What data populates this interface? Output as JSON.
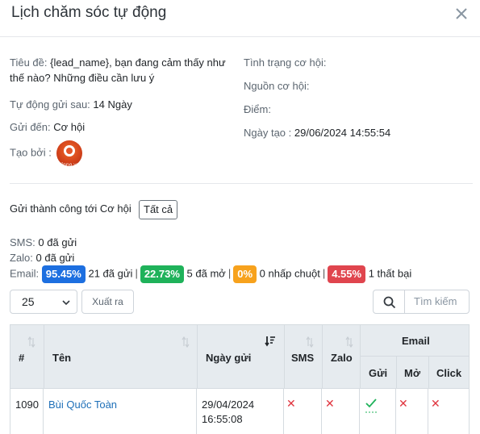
{
  "modal": {
    "title": "Lịch chăm sóc tự động"
  },
  "details": {
    "subject_label": "Tiêu đề:",
    "subject_value": "{lead_name}, bạn đang cảm thấy như thế nào? Những điều cần lưu ý",
    "auto_send_label": "Tự động gửi sau:",
    "auto_send_value": "14 Ngày",
    "send_to_label": "Gửi đến:",
    "send_to_value": "Cơ hội",
    "created_by_label": "Tạo bởi :",
    "creator_avatar_text": "Vinno.vn",
    "status_label": "Tình trạng cơ hội:",
    "source_label": "Nguồn cơ hội:",
    "score_label": "Điểm:",
    "created_date_label": "Ngày tạo :",
    "created_date_value": "29/06/2024 14:55:54"
  },
  "stats": {
    "sent_to_text": "Gửi thành công tới Cơ hội",
    "all_button": "Tất cả",
    "sms_label": "SMS:",
    "sms_value": "0 đã gửi",
    "zalo_label": "Zalo:",
    "zalo_value": "0 đã gửi",
    "email_label": "Email:",
    "email_sent_pct": "95.45%",
    "email_sent_text": "21 đã gửi",
    "email_open_pct": "22.73%",
    "email_open_text": "5 đã mở",
    "email_click_pct": "0%",
    "email_click_text": "0 nhấp chuột",
    "email_fail_pct": "4.55%",
    "email_fail_text": "1 thất bại",
    "separator": "|"
  },
  "toolbar": {
    "page_size": "25",
    "export_label": "Xuất ra",
    "search_placeholder": "Tìm kiếm"
  },
  "table": {
    "headers": {
      "id": "#",
      "name": "Tên",
      "date": "Ngày gửi",
      "sms": "SMS",
      "zalo": "Zalo",
      "email": "Email",
      "email_sent": "Gửi",
      "email_open": "Mở",
      "email_click": "Click"
    },
    "rows": [
      {
        "id": "1090",
        "name": "Bùi Quốc Toàn",
        "date_line1": "29/04/2024",
        "date_line2": "16:55:08",
        "sms": "✕",
        "zalo": "✕",
        "email_open": "✕",
        "email_click": "✕"
      }
    ]
  },
  "colors": {
    "sent_badge": "#1d6fe0",
    "open_badge": "#1fb25a",
    "click_badge": "#f7a21d",
    "fail_badge": "#e0454e",
    "link": "#1d6fb8"
  }
}
